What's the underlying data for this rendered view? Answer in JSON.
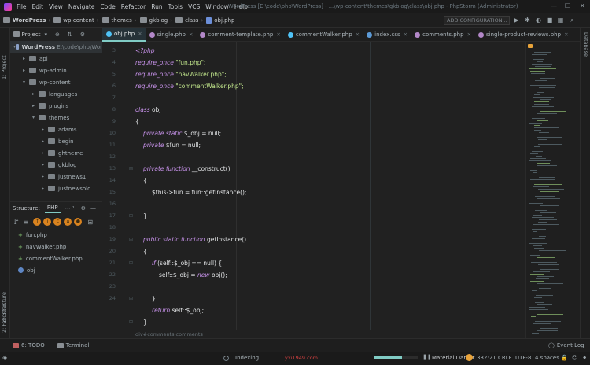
{
  "menubar": {
    "items": [
      "File",
      "Edit",
      "View",
      "Navigate",
      "Code",
      "Refactor",
      "Run",
      "Tools",
      "VCS",
      "Window",
      "Help"
    ],
    "window_title": "WordPress [E:\\code\\php\\WordPress] - ...\\wp-content\\themes\\gkblog\\class\\obj.php - PhpStorm (Administrator)",
    "minimize": "—",
    "maximize": "☐",
    "close": "✕"
  },
  "navbar": {
    "crumbs": [
      "WordPress",
      "wp-content",
      "themes",
      "gkblog",
      "class",
      "obj.php"
    ],
    "run_config": "ADD CONFIGURATION..."
  },
  "left_strip": {
    "project_label": "1: Project",
    "structure_label": "Z: Structure",
    "favorites_label": "2: Favorites"
  },
  "right_strip": {
    "database_label": "Database"
  },
  "project_panel": {
    "title": "Project",
    "root": {
      "name": "WordPress",
      "path": "E:\\code\\php\\Wor"
    },
    "items": [
      {
        "name": "api",
        "indent": 1,
        "expanded": false
      },
      {
        "name": "wp-admin",
        "indent": 1,
        "expanded": false
      },
      {
        "name": "wp-content",
        "indent": 1,
        "expanded": true
      },
      {
        "name": "languages",
        "indent": 2,
        "expanded": false
      },
      {
        "name": "plugins",
        "indent": 2,
        "expanded": false
      },
      {
        "name": "themes",
        "indent": 2,
        "expanded": true
      },
      {
        "name": "adams",
        "indent": 3,
        "expanded": false
      },
      {
        "name": "begin",
        "indent": 3,
        "expanded": false
      },
      {
        "name": "ghtheme",
        "indent": 3,
        "expanded": false
      },
      {
        "name": "gkblog",
        "indent": 3,
        "expanded": false
      },
      {
        "name": "justnews1",
        "indent": 3,
        "expanded": false
      },
      {
        "name": "justnewsold",
        "indent": 3,
        "expanded": false
      }
    ]
  },
  "structure_panel": {
    "title": "Structure:",
    "tab": "PHP",
    "tab_extra": "⋯ ¹",
    "items": [
      "fun.php",
      "navWalker.php",
      "commentWalker.php",
      "obj"
    ]
  },
  "tabs": [
    {
      "label": "obj.php",
      "active": true,
      "color": "#4fc3f7"
    },
    {
      "label": "single.php",
      "active": false,
      "color": "#b388c8"
    },
    {
      "label": "comment-template.php",
      "active": false,
      "color": "#b388c8"
    },
    {
      "label": "commentWalker.php",
      "active": false,
      "color": "#4fc3f7"
    },
    {
      "label": "index.css",
      "active": false,
      "color": "#5c9ad6"
    },
    {
      "label": "comments.php",
      "active": false,
      "color": "#b388c8"
    },
    {
      "label": "single-product-reviews.php",
      "active": false,
      "color": "#b388c8"
    }
  ],
  "editor": {
    "line_numbers": [
      "3",
      "4",
      "5",
      "6",
      "7",
      "8",
      "9",
      "10",
      "11",
      "12",
      "13",
      "14",
      "15",
      "16",
      "17",
      "18",
      "19",
      "20",
      "21",
      "22",
      "23",
      "24"
    ],
    "code": {
      "l3": "<?php",
      "l4_kw": "require_once",
      "l4_str": " \"fun.php\";",
      "l5_kw": "require_once",
      "l5_str": " \"navWalker.php\";",
      "l6_kw": "require_once",
      "l6_str": " \"commentWalker.php\";",
      "l8_kw": "class",
      "l8_name": " obj",
      "l9": "{",
      "l10_kw": "private static",
      "l10_rest": " $_obj = null;",
      "l11_kw": "private",
      "l11_rest": " $fun = null;",
      "l13_kw": "private function",
      "l13_rest": " __construct()",
      "l14": "{",
      "l15": "$this->fun = fun::getInstance();",
      "l17": "}",
      "l19_kw": "public static function",
      "l19_rest": " getInstance()",
      "l20": "{",
      "l21_kw": "if",
      "l21_rest": " (self::$_obj == null) {",
      "l22_a": "self::$_obj = ",
      "l22_kw": "new",
      "l22_b": " obj();",
      "l24": "}",
      "l25_kw": "return",
      "l25_rest": " self::$_obj;",
      "l26": "}"
    },
    "bottom_breadcrumb": "div#comments.comments"
  },
  "bottom_tabs": {
    "todo": "6: TODO",
    "terminal": "Terminal",
    "event_log": "Event Log"
  },
  "statusbar": {
    "indexing": "Indexing...",
    "watermark": "yxi1949.com",
    "index_progress": 0.65,
    "theme": "Material Darker",
    "position": "332:21",
    "line_sep": "CRLF",
    "encoding": "UTF-8",
    "indent": "4 spaces"
  },
  "colors": {
    "accent": "#80cbc4",
    "keyword": "#c792ea",
    "string": "#c3e88d",
    "theme_dot": "#e8a33a"
  }
}
